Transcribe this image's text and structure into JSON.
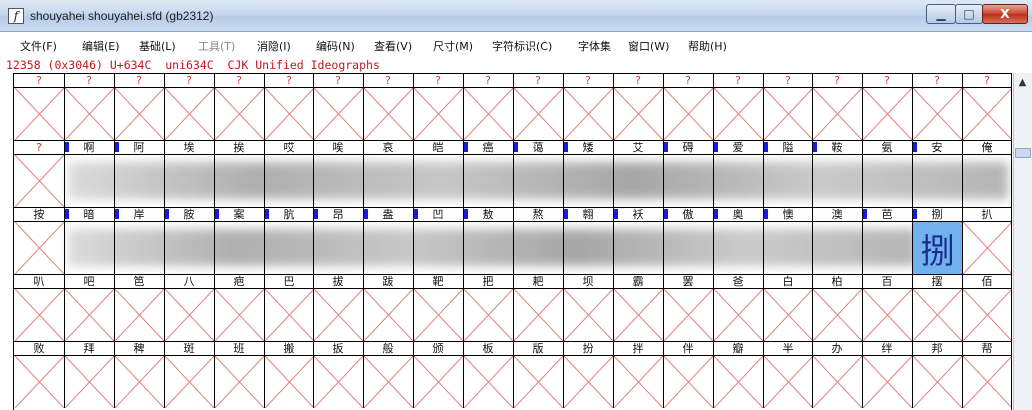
{
  "window": {
    "title": "shouyahei  shouyahei.sfd (gb2312)",
    "buttons": {
      "minimize": "▁",
      "maximize": "□",
      "close": "X"
    }
  },
  "menubar": {
    "items": [
      {
        "label": "文件(F)",
        "enabled": true
      },
      {
        "label": "编辑(E)",
        "enabled": true
      },
      {
        "label": "基础(L)",
        "enabled": true
      },
      {
        "label": "工具(T)",
        "enabled": false
      },
      {
        "label": "消隐(I)",
        "enabled": true
      },
      {
        "label": "编码(N)",
        "enabled": true
      },
      {
        "label": "查看(V)",
        "enabled": true
      },
      {
        "label": "尺寸(M)",
        "enabled": true
      },
      {
        "label": "字符标识(C)",
        "enabled": true
      },
      {
        "label": "字体集",
        "enabled": true
      },
      {
        "label": "窗口(W)",
        "enabled": true
      },
      {
        "label": "帮助(H)",
        "enabled": true
      }
    ]
  },
  "info_line": "12358 (0x3046) U+634C  uni634C  CJK Unified Ideographs",
  "font_grid": {
    "columns": 20,
    "selected": {
      "row": 2,
      "col": 18,
      "char": "捌"
    },
    "rows": [
      {
        "labels": [
          "?",
          "?",
          "?",
          "?",
          "?",
          "?",
          "?",
          "?",
          "?",
          "?",
          "?",
          "?",
          "?",
          "?",
          "?",
          "?",
          "?",
          "?",
          "?",
          "?"
        ],
        "missing": [
          true,
          true,
          true,
          true,
          true,
          true,
          true,
          true,
          true,
          true,
          true,
          true,
          true,
          true,
          true,
          true,
          true,
          true,
          true,
          true
        ],
        "marked": [
          false,
          false,
          false,
          false,
          false,
          false,
          false,
          false,
          false,
          false,
          false,
          false,
          false,
          false,
          false,
          false,
          false,
          false,
          false,
          false
        ],
        "content": "empty"
      },
      {
        "labels": [
          "?",
          "啊",
          "阿",
          "埃",
          "挨",
          "哎",
          "唉",
          "哀",
          "皑",
          "癌",
          "蔼",
          "矮",
          "艾",
          "碍",
          "爱",
          "隘",
          "鞍",
          "氨",
          "安",
          "俺"
        ],
        "missing": [
          true,
          false,
          false,
          false,
          false,
          false,
          false,
          false,
          false,
          false,
          false,
          false,
          false,
          false,
          false,
          false,
          false,
          false,
          false,
          false
        ],
        "marked": [
          false,
          true,
          true,
          false,
          false,
          false,
          false,
          false,
          false,
          true,
          true,
          true,
          false,
          true,
          true,
          true,
          true,
          false,
          true,
          false
        ],
        "content": "blurred"
      },
      {
        "labels": [
          "按",
          "暗",
          "岸",
          "胺",
          "案",
          "肮",
          "昂",
          "盎",
          "凹",
          "敖",
          "熬",
          "翱",
          "袄",
          "傲",
          "奥",
          "懊",
          "澳",
          "芭",
          "捌",
          "扒"
        ],
        "missing": [
          false,
          false,
          false,
          false,
          false,
          false,
          false,
          false,
          false,
          false,
          false,
          false,
          false,
          false,
          false,
          false,
          false,
          false,
          false,
          false
        ],
        "marked": [
          false,
          true,
          true,
          true,
          true,
          true,
          true,
          true,
          true,
          true,
          false,
          true,
          true,
          true,
          true,
          true,
          false,
          true,
          true,
          false
        ],
        "content": "blurred"
      },
      {
        "labels": [
          "叭",
          "吧",
          "笆",
          "八",
          "疤",
          "巴",
          "拔",
          "跋",
          "靶",
          "把",
          "耙",
          "坝",
          "霸",
          "罢",
          "爸",
          "白",
          "柏",
          "百",
          "摆",
          "佰"
        ],
        "missing": [
          false,
          false,
          false,
          false,
          false,
          false,
          false,
          false,
          false,
          false,
          false,
          false,
          false,
          false,
          false,
          false,
          false,
          false,
          false,
          false
        ],
        "marked": [
          false,
          false,
          false,
          false,
          false,
          false,
          false,
          false,
          false,
          false,
          false,
          false,
          false,
          false,
          false,
          false,
          false,
          false,
          false,
          false
        ],
        "content": "empty"
      },
      {
        "labels": [
          "败",
          "拜",
          "稗",
          "斑",
          "班",
          "搬",
          "扳",
          "般",
          "颁",
          "板",
          "版",
          "扮",
          "拌",
          "伴",
          "瓣",
          "半",
          "办",
          "绊",
          "邦",
          "帮"
        ],
        "missing": [
          false,
          false,
          false,
          false,
          false,
          false,
          false,
          false,
          false,
          false,
          false,
          false,
          false,
          false,
          false,
          false,
          false,
          false,
          false,
          false
        ],
        "marked": [
          false,
          false,
          false,
          false,
          false,
          false,
          false,
          false,
          false,
          false,
          false,
          false,
          false,
          false,
          false,
          false,
          false,
          false,
          false,
          false
        ],
        "content": "empty"
      }
    ]
  },
  "colors": {
    "missing_label": "#d43c2c",
    "info_text": "#c0181c",
    "placeholder_cross": "#e08080",
    "mark": "#1a1adf",
    "selection": "#6fb2ee"
  },
  "icons": {
    "app": "fontforge-icon",
    "scroll_up": "▲"
  }
}
